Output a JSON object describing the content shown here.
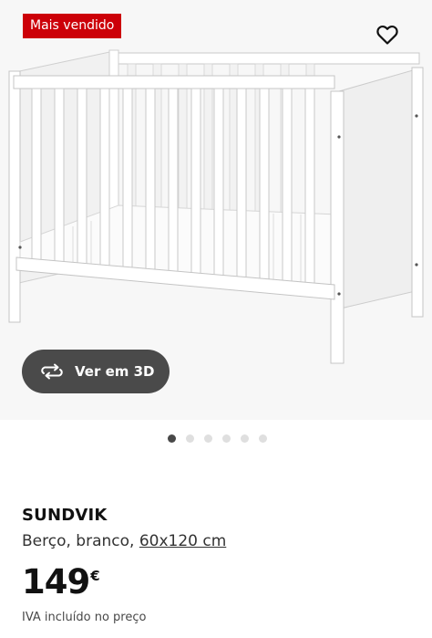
{
  "badge": {
    "label": "Mais vendido",
    "color": "#cc0008"
  },
  "favorite": {
    "icon": "heart-outline-icon"
  },
  "viewer": {
    "label": "Ver em 3D",
    "icon": "rotate-3d-icon"
  },
  "carousel": {
    "total": 6,
    "active_index": 0
  },
  "product": {
    "name": "SUNDVIK",
    "type": "Berço, branco, ",
    "dimensions": "60x120 cm",
    "price_amount": "149",
    "price_currency": "€",
    "vat_note": "IVA incluído no preço"
  }
}
